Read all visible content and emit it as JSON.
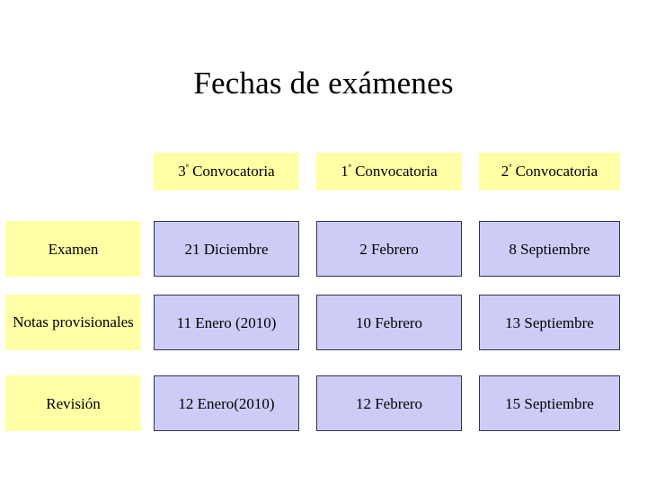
{
  "slide": {
    "title": "Fechas de exámenes",
    "background": "#ffffff"
  },
  "colors": {
    "header_fill": "#ffffa6",
    "rowlabel_fill": "#ffffa6",
    "data_fill": "#ccccf7",
    "data_border": "#333355",
    "text": "#000000"
  },
  "table": {
    "corner_label": "",
    "column_headers": [
      "3ª Convocatoria",
      "1ª Convocatoria",
      "2ª Convocatoria"
    ],
    "row_labels": [
      "Examen",
      "Notas provisionales",
      "Revisión"
    ],
    "rows": [
      {
        "label": "Examen",
        "cells": [
          "21 Diciembre",
          "2 Febrero",
          "8 Septiembre"
        ]
      },
      {
        "label": "Notas provisionales",
        "cells": [
          "11 Enero (2010)",
          "10 Febrero",
          "13 Septiembre"
        ]
      },
      {
        "label": "Revisión",
        "cells": [
          "12 Enero(2010)",
          "12 Febrero",
          "15 Septiembre"
        ]
      }
    ]
  }
}
